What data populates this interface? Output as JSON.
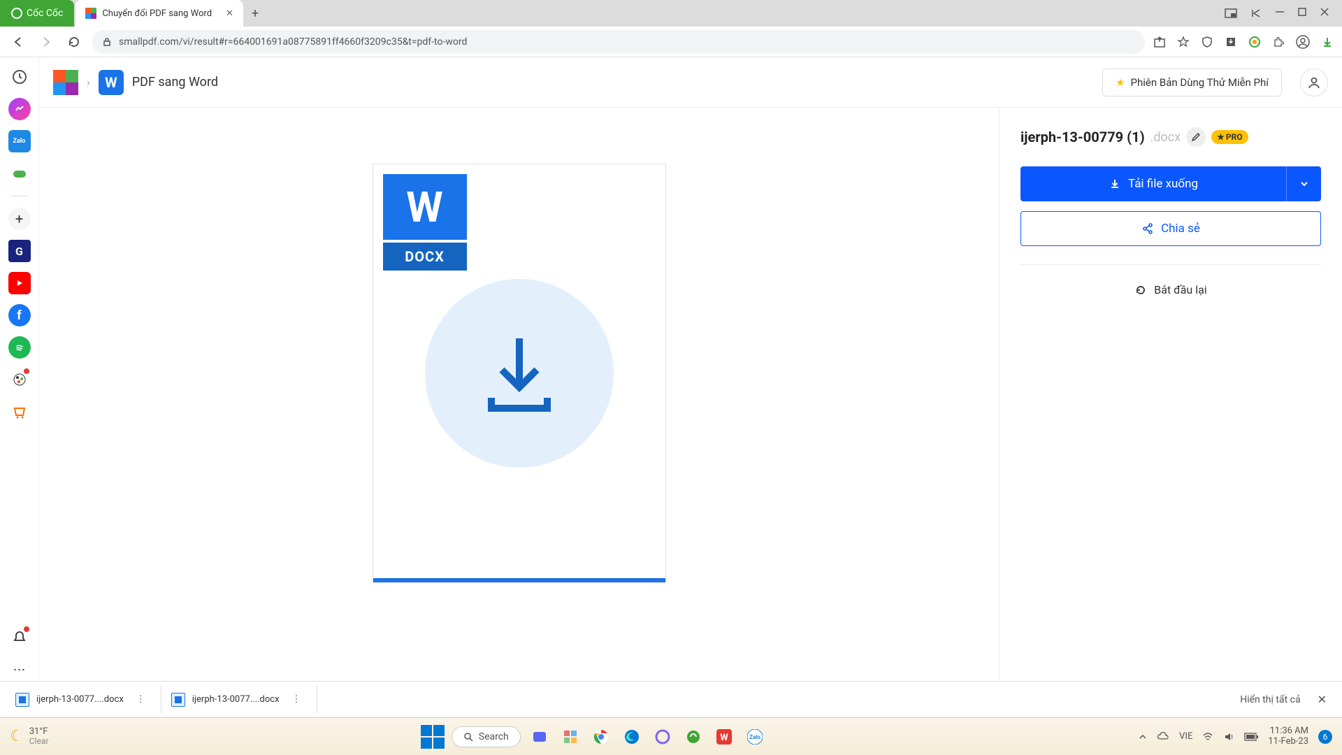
{
  "browser": {
    "coccoc_tab": "Cốc Cốc",
    "active_tab": "Chuyển đổi PDF sang Word",
    "url": "smallpdf.com/vi/result#r=664001691a08775891ff4660f3209c35&t=pdf-to-word"
  },
  "app": {
    "tool_letter": "W",
    "tool_title": "PDF sang Word",
    "trial_label": "Phiên Bản Dùng Thử Miễn Phí"
  },
  "preview": {
    "badge_letter": "W",
    "badge_ext": "DOCX"
  },
  "panel": {
    "file_name": "ijerph-13-00779 (1)",
    "file_ext": ".docx",
    "pro_label": "PRO",
    "download_label": "Tải file xuống",
    "share_label": "Chia sẻ",
    "restart_label": "Bắt đầu lại"
  },
  "downloads": {
    "items": [
      {
        "name": "ijerph-13-0077....docx"
      },
      {
        "name": "ijerph-13-0077....docx"
      }
    ],
    "show_all": "Hiển thị tất cả"
  },
  "taskbar": {
    "temp": "31°F",
    "cond": "Clear",
    "search": "Search",
    "lang": "VIE",
    "time": "11:36 AM",
    "date": "11-Feb-23",
    "notif_count": "6"
  }
}
